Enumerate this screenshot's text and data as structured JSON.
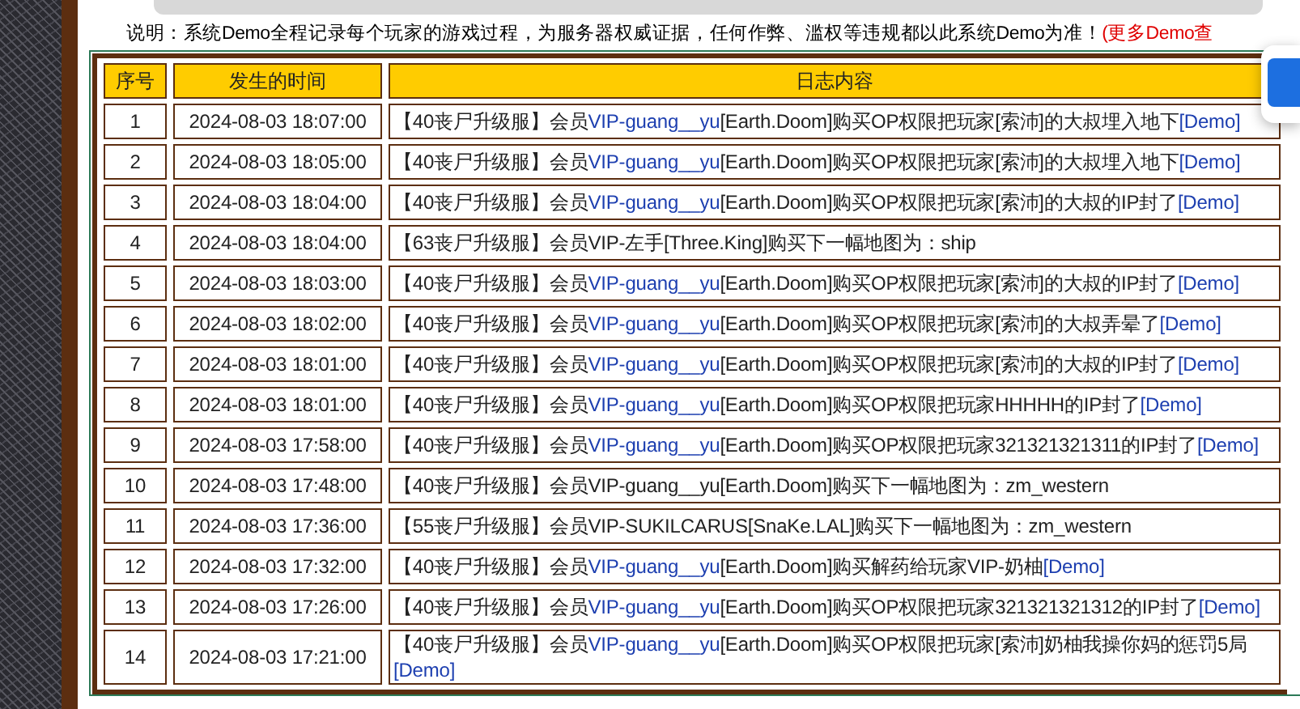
{
  "note": {
    "text": "说明：系统Demo全程记录每个玩家的游戏过程，为服务器权威证据，任何作弊、滥权等违规都以此系统Demo为准！",
    "link": "(更多Demo查"
  },
  "table": {
    "columns": [
      "序号",
      "发生的时间",
      "日志内容"
    ],
    "rows": [
      {
        "index": "1",
        "time": "2024-08-03 18:07:00",
        "log": [
          {
            "kind": "text",
            "text": "【40丧尸升级服】会员"
          },
          {
            "kind": "link",
            "text": "VIP-guang__yu"
          },
          {
            "kind": "text",
            "text": "[Earth.Doom]购买OP权限把玩家[索沛]的大叔埋入地下"
          },
          {
            "kind": "link",
            "text": "[Demo]"
          }
        ]
      },
      {
        "index": "2",
        "time": "2024-08-03 18:05:00",
        "log": [
          {
            "kind": "text",
            "text": "【40丧尸升级服】会员"
          },
          {
            "kind": "link",
            "text": "VIP-guang__yu"
          },
          {
            "kind": "text",
            "text": "[Earth.Doom]购买OP权限把玩家[索沛]的大叔埋入地下"
          },
          {
            "kind": "link",
            "text": "[Demo]"
          }
        ]
      },
      {
        "index": "3",
        "time": "2024-08-03 18:04:00",
        "log": [
          {
            "kind": "text",
            "text": "【40丧尸升级服】会员"
          },
          {
            "kind": "link",
            "text": "VIP-guang__yu"
          },
          {
            "kind": "text",
            "text": "[Earth.Doom]购买OP权限把玩家[索沛]的大叔的IP封了"
          },
          {
            "kind": "link",
            "text": "[Demo]"
          }
        ]
      },
      {
        "index": "4",
        "time": "2024-08-03 18:04:00",
        "log": [
          {
            "kind": "text",
            "text": "【63丧尸升级服】会员VIP-左手[Three.King]购买下一幅地图为：ship"
          }
        ]
      },
      {
        "index": "5",
        "time": "2024-08-03 18:03:00",
        "log": [
          {
            "kind": "text",
            "text": "【40丧尸升级服】会员"
          },
          {
            "kind": "link",
            "text": "VIP-guang__yu"
          },
          {
            "kind": "text",
            "text": "[Earth.Doom]购买OP权限把玩家[索沛]的大叔的IP封了"
          },
          {
            "kind": "link",
            "text": "[Demo]"
          }
        ]
      },
      {
        "index": "6",
        "time": "2024-08-03 18:02:00",
        "log": [
          {
            "kind": "text",
            "text": "【40丧尸升级服】会员"
          },
          {
            "kind": "link",
            "text": "VIP-guang__yu"
          },
          {
            "kind": "text",
            "text": "[Earth.Doom]购买OP权限把玩家[索沛]的大叔弄晕了"
          },
          {
            "kind": "link",
            "text": "[Demo]"
          }
        ]
      },
      {
        "index": "7",
        "time": "2024-08-03 18:01:00",
        "log": [
          {
            "kind": "text",
            "text": "【40丧尸升级服】会员"
          },
          {
            "kind": "link",
            "text": "VIP-guang__yu"
          },
          {
            "kind": "text",
            "text": "[Earth.Doom]购买OP权限把玩家[索沛]的大叔的IP封了"
          },
          {
            "kind": "link",
            "text": "[Demo]"
          }
        ]
      },
      {
        "index": "8",
        "time": "2024-08-03 18:01:00",
        "log": [
          {
            "kind": "text",
            "text": "【40丧尸升级服】会员"
          },
          {
            "kind": "link",
            "text": "VIP-guang__yu"
          },
          {
            "kind": "text",
            "text": "[Earth.Doom]购买OP权限把玩家HHHHH的IP封了"
          },
          {
            "kind": "link",
            "text": "[Demo]"
          }
        ]
      },
      {
        "index": "9",
        "time": "2024-08-03 17:58:00",
        "log": [
          {
            "kind": "text",
            "text": "【40丧尸升级服】会员"
          },
          {
            "kind": "link",
            "text": "VIP-guang__yu"
          },
          {
            "kind": "text",
            "text": "[Earth.Doom]购买OP权限把玩家321321321311的IP封了"
          },
          {
            "kind": "link",
            "text": "[Demo]"
          }
        ]
      },
      {
        "index": "10",
        "time": "2024-08-03 17:48:00",
        "log": [
          {
            "kind": "text",
            "text": "【40丧尸升级服】会员VIP-guang__yu[Earth.Doom]购买下一幅地图为：zm_western"
          }
        ]
      },
      {
        "index": "11",
        "time": "2024-08-03 17:36:00",
        "log": [
          {
            "kind": "text",
            "text": "【55丧尸升级服】会员VIP-SUKILCARUS[SnaKe.LAL]购买下一幅地图为：zm_western"
          }
        ]
      },
      {
        "index": "12",
        "time": "2024-08-03 17:32:00",
        "log": [
          {
            "kind": "text",
            "text": "【40丧尸升级服】会员"
          },
          {
            "kind": "link",
            "text": "VIP-guang__yu"
          },
          {
            "kind": "text",
            "text": "[Earth.Doom]购买解药给玩家VIP-奶柚"
          },
          {
            "kind": "link",
            "text": "[Demo]"
          }
        ]
      },
      {
        "index": "13",
        "time": "2024-08-03 17:26:00",
        "log": [
          {
            "kind": "text",
            "text": "【40丧尸升级服】会员"
          },
          {
            "kind": "link",
            "text": "VIP-guang__yu"
          },
          {
            "kind": "text",
            "text": "[Earth.Doom]购买OP权限把玩家321321321312的IP封了"
          },
          {
            "kind": "link",
            "text": "[Demo]"
          }
        ]
      },
      {
        "index": "14",
        "time": "2024-08-03 17:21:00",
        "log": [
          {
            "kind": "text",
            "text": "【40丧尸升级服】会员"
          },
          {
            "kind": "link",
            "text": "VIP-guang__yu"
          },
          {
            "kind": "text",
            "text": "[Earth.Doom]购买OP权限把玩家[索沛]奶柚我操你妈的惩罚5局"
          },
          {
            "kind": "link",
            "text": "[Demo]"
          }
        ]
      }
    ]
  }
}
